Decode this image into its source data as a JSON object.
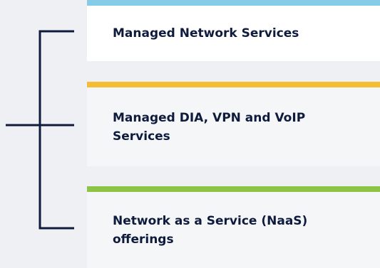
{
  "services": {
    "items": [
      {
        "label": "Managed Network Services",
        "accent_color": "#86cce6"
      },
      {
        "label": "Managed DIA, VPN and VoIP Services",
        "accent_color": "#f5bd33"
      },
      {
        "label": "Network as a Service (NaaS) offerings",
        "accent_color": "#8ec445"
      }
    ]
  },
  "bracket": {
    "color": "#0e1b3d"
  }
}
